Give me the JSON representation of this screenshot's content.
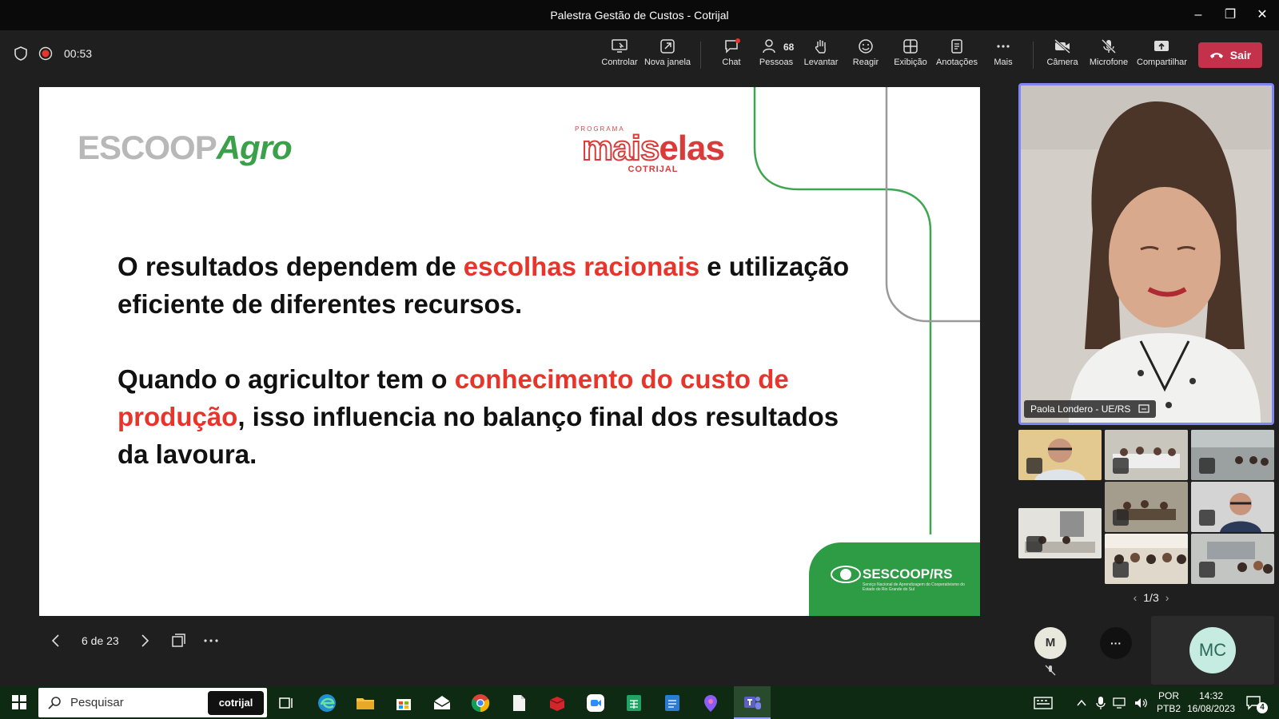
{
  "window": {
    "title": "Palestra Gestão de Custos - Cotrijal"
  },
  "toolbar": {
    "timer": "00:53",
    "items": [
      {
        "label": "Controlar"
      },
      {
        "label": "Nova janela"
      },
      {
        "label": "Chat"
      },
      {
        "label": "Pessoas",
        "count": "68"
      },
      {
        "label": "Levantar"
      },
      {
        "label": "Reagir"
      },
      {
        "label": "Exibição"
      },
      {
        "label": "Anotações"
      },
      {
        "label": "Mais"
      },
      {
        "label": "Câmera"
      },
      {
        "label": "Microfone"
      },
      {
        "label": "Compartilhar"
      }
    ],
    "leave_label": "Sair"
  },
  "slide": {
    "logo_left_a": "ESCOOP",
    "logo_left_b": "Agro",
    "logo_mid_top": "PROGRAMA",
    "logo_mid_a": "mais",
    "logo_mid_b": "elas",
    "logo_mid_bottom": "COTRIJAL",
    "p1_a": "O resultados dependem de ",
    "p1_hl": "escolhas racionais",
    "p1_b": " e utilização eficiente de diferentes recursos.",
    "p2_a": "Quando o agricultor tem o ",
    "p2_hl": "conhecimento do custo de produção",
    "p2_b": ", isso influencia no balanço final dos resultados da lavoura.",
    "footer_logo": "SESCOOP/RS",
    "footer_sub": "Serviço Nacional de Aprendizagem do Cooperativismo do Estado do Rio Grande do Sul"
  },
  "slide_controls": {
    "page": "6 de 23"
  },
  "participants": {
    "spotlight_name": "Paola Londero - UE/RS",
    "pager": "1/3",
    "avatar_small": "M",
    "avatar_more": "···",
    "avatar_self": "MC"
  },
  "taskbar": {
    "search_placeholder": "Pesquisar",
    "search_badge": "cotrijal",
    "lang_top": "POR",
    "lang_bottom": "PTB2",
    "time": "14:32",
    "date": "16/08/2023",
    "notif_count": "4"
  },
  "colors": {
    "accent_red": "#e8352b",
    "green": "#2e9b45",
    "leave_red": "#c4314b",
    "spotlight_border": "#7f85f5"
  }
}
